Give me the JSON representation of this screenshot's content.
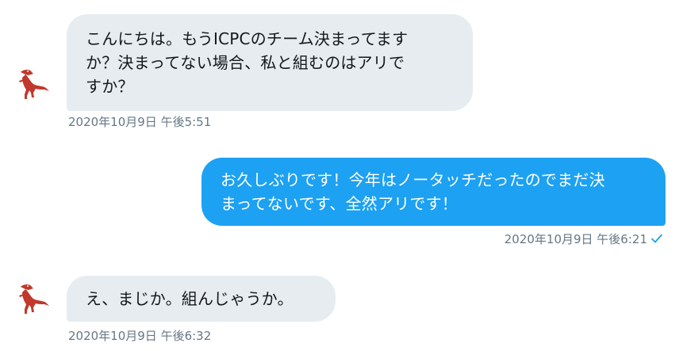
{
  "messages": [
    {
      "direction": "incoming",
      "text": "こんにちは。もうICPCのチーム決まってます\nか？決まってない場合、私と組むのはアリで\nすか？",
      "timestamp": "2020年10月9日 午後5:51",
      "avatar_icon": "raptor-dinosaur-icon"
    },
    {
      "direction": "outgoing",
      "text": "お久しぶりです！今年はノータッチだったのでまだ決\nまってないです、全然アリです！",
      "timestamp": "2020年10月9日 午後6:21",
      "status_icon": "checkmark-icon"
    },
    {
      "direction": "incoming",
      "text": "え、まじか。組んじゃうか。",
      "timestamp": "2020年10月9日 午後6:32",
      "avatar_icon": "raptor-dinosaur-icon"
    }
  ],
  "colors": {
    "incoming_bubble": "#e6ecf0",
    "outgoing_bubble": "#1da1f2",
    "timestamp": "#657786",
    "check": "#1da1f2"
  }
}
